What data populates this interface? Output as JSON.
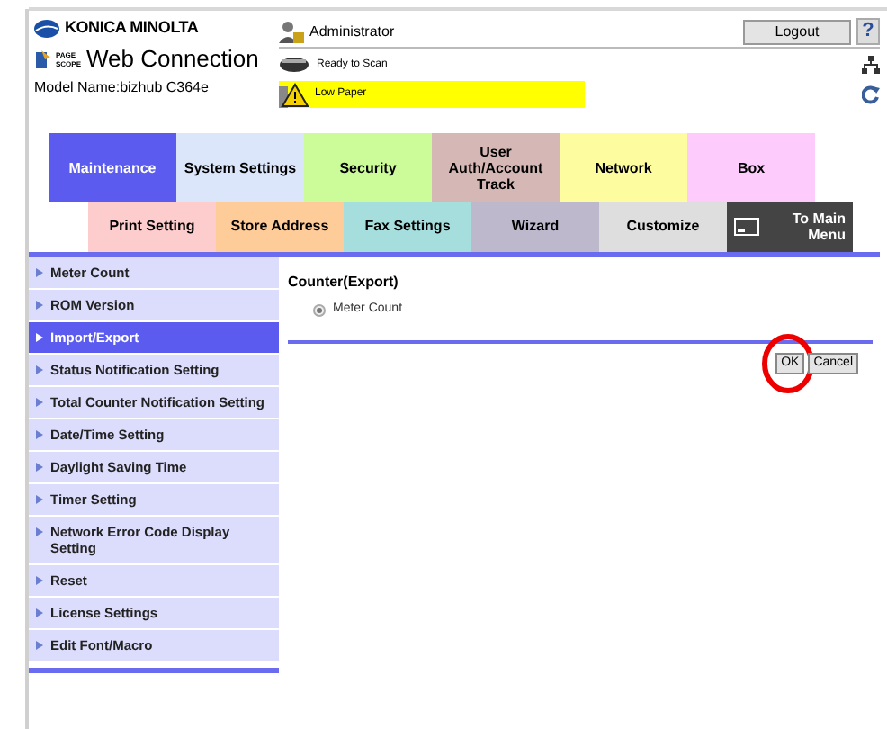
{
  "header": {
    "brand": "KONICA MINOLTA",
    "product_logo": "PAGE SCOPE",
    "product": "Web Connection",
    "model": "Model Name:bizhub C364e",
    "user": "Administrator",
    "logout": "Logout",
    "help": "?",
    "status": "Ready to Scan",
    "warning": "Low Paper"
  },
  "tabs": [
    {
      "label": "Maintenance",
      "selected": true,
      "color": "#5b5bf0"
    },
    {
      "label": "System Settings",
      "selected": false,
      "color": "#dce6fb"
    },
    {
      "label": "Security",
      "selected": false,
      "color": "#ccfb99"
    },
    {
      "label": "User Auth/Account Track",
      "selected": false,
      "color": "#d5b8b5"
    },
    {
      "label": "Network",
      "selected": false,
      "color": "#fdfd9f"
    },
    {
      "label": "Box",
      "selected": false,
      "color": "#fdccfd"
    }
  ],
  "subtabs": [
    {
      "label": "Print Setting",
      "kind": "tab",
      "color": "#fdcccc"
    },
    {
      "label": "Store Address",
      "kind": "tab",
      "color": "#fdcc99"
    },
    {
      "label": "Fax Settings",
      "kind": "tab",
      "color": "#a6dede"
    },
    {
      "label": "Wizard",
      "kind": "tab",
      "color": "#bdb8cc"
    },
    {
      "label": "Customize",
      "kind": "tab",
      "color": "#dedede"
    },
    {
      "label": "To Main Menu",
      "kind": "main-menu",
      "color": "#444444"
    }
  ],
  "sidebar": {
    "items": [
      {
        "label": "Meter Count",
        "selected": false
      },
      {
        "label": "ROM Version",
        "selected": false
      },
      {
        "label": "Import/Export",
        "selected": true
      },
      {
        "label": "Status Notification Setting",
        "selected": false
      },
      {
        "label": "Total Counter Notification Setting",
        "selected": false
      },
      {
        "label": "Date/Time Setting",
        "selected": false
      },
      {
        "label": "Daylight Saving Time",
        "selected": false
      },
      {
        "label": "Timer Setting",
        "selected": false
      },
      {
        "label": "Network Error Code Display Setting",
        "selected": false
      },
      {
        "label": "Reset",
        "selected": false
      },
      {
        "label": "License Settings",
        "selected": false
      },
      {
        "label": "Edit Font/Macro",
        "selected": false
      }
    ]
  },
  "main": {
    "title": "Counter(Export)",
    "options": [
      {
        "label": "Meter Count",
        "selected": true
      }
    ],
    "buttons": [
      "OK",
      "Cancel"
    ]
  }
}
